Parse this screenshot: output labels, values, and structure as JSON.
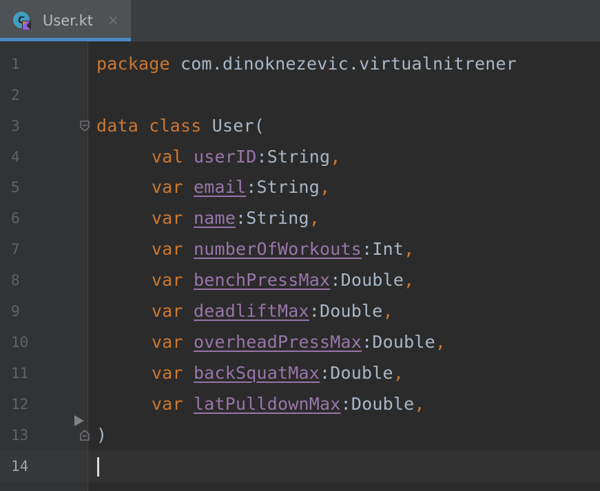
{
  "tab": {
    "filename": "User.kt",
    "close_glyph": "×",
    "icon": "kotlin-class-icon"
  },
  "gutter": {
    "line_numbers": [
      "1",
      "2",
      "3",
      "4",
      "5",
      "6",
      "7",
      "8",
      "9",
      "10",
      "11",
      "12",
      "13",
      "14"
    ],
    "active_line": "14"
  },
  "code": {
    "line1": {
      "kw": "package",
      "rest": " com.dinoknezevic.virtualnitrener"
    },
    "line3": {
      "kw1": "data",
      "kw2": "class",
      "rest": " User("
    },
    "params": [
      {
        "kw": "val",
        "name": "userID",
        "underlined": false,
        "type": ":String",
        "comma": ","
      },
      {
        "kw": "var",
        "name": "email",
        "underlined": true,
        "type": ":String",
        "comma": ","
      },
      {
        "kw": "var",
        "name": "name",
        "underlined": true,
        "type": ":String",
        "comma": ","
      },
      {
        "kw": "var",
        "name": "numberOfWorkouts",
        "underlined": true,
        "type": ":Int",
        "comma": ","
      },
      {
        "kw": "var",
        "name": "benchPressMax",
        "underlined": true,
        "type": ":Double",
        "comma": ","
      },
      {
        "kw": "var",
        "name": "deadliftMax",
        "underlined": true,
        "type": ":Double",
        "comma": ","
      },
      {
        "kw": "var",
        "name": "overheadPressMax",
        "underlined": true,
        "type": ":Double",
        "comma": ","
      },
      {
        "kw": "var",
        "name": "backSquatMax",
        "underlined": true,
        "type": ":Double",
        "comma": ","
      },
      {
        "kw": "var",
        "name": "latPulldownMax",
        "underlined": true,
        "type": ":Double",
        "comma": ","
      }
    ],
    "line13": ")"
  },
  "colors": {
    "keyword": "#cc7832",
    "property": "#9876aa",
    "default_text": "#a9b7c6",
    "background": "#2b2b2b",
    "tab_accent": "#4a88c7"
  }
}
